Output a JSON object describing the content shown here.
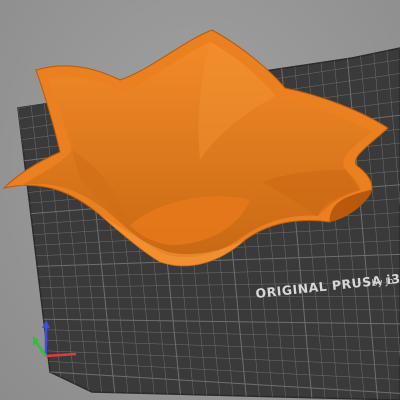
{
  "viewer": {
    "bed_label": "ORIGINAL PRUSA i3",
    "bed_sublabel": "by Jo"
  },
  "model": {
    "name": "star-bowl",
    "color": "#E87D1E"
  },
  "colors": {
    "background": "#969696",
    "bed_surface": "#3b3b3b",
    "bed_grid": "#6f6f6f",
    "model_orange": "#E87D1E",
    "axis_x": "#e23b3b",
    "axis_y": "#2fbf3a",
    "axis_z": "#3a4ee0"
  }
}
